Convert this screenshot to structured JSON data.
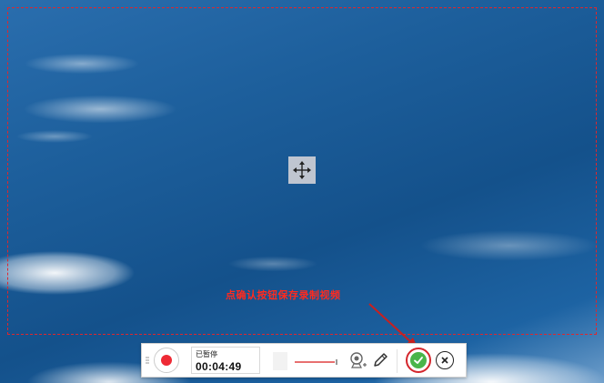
{
  "annotation": {
    "text": "点确认按钮保存录制视频",
    "color": "#ff2a1f"
  },
  "capture_frame": {
    "border_color": "#e0262d",
    "style": "dashed"
  },
  "toolbar": {
    "status_label": "已暂停",
    "elapsed_time": "00:04:49",
    "record_color": "#ee2a35",
    "confirm_color": "#49b54a",
    "confirm_ring_color": "#d4262c",
    "icons": {
      "grip": "grip-icon",
      "record": "record-icon",
      "audio": "audio-level-icon",
      "webcam": "webcam-add-icon",
      "pen": "pen-icon",
      "confirm": "check-icon",
      "close": "close-icon"
    }
  },
  "move_handle": {
    "icon": "move-arrows-icon"
  }
}
